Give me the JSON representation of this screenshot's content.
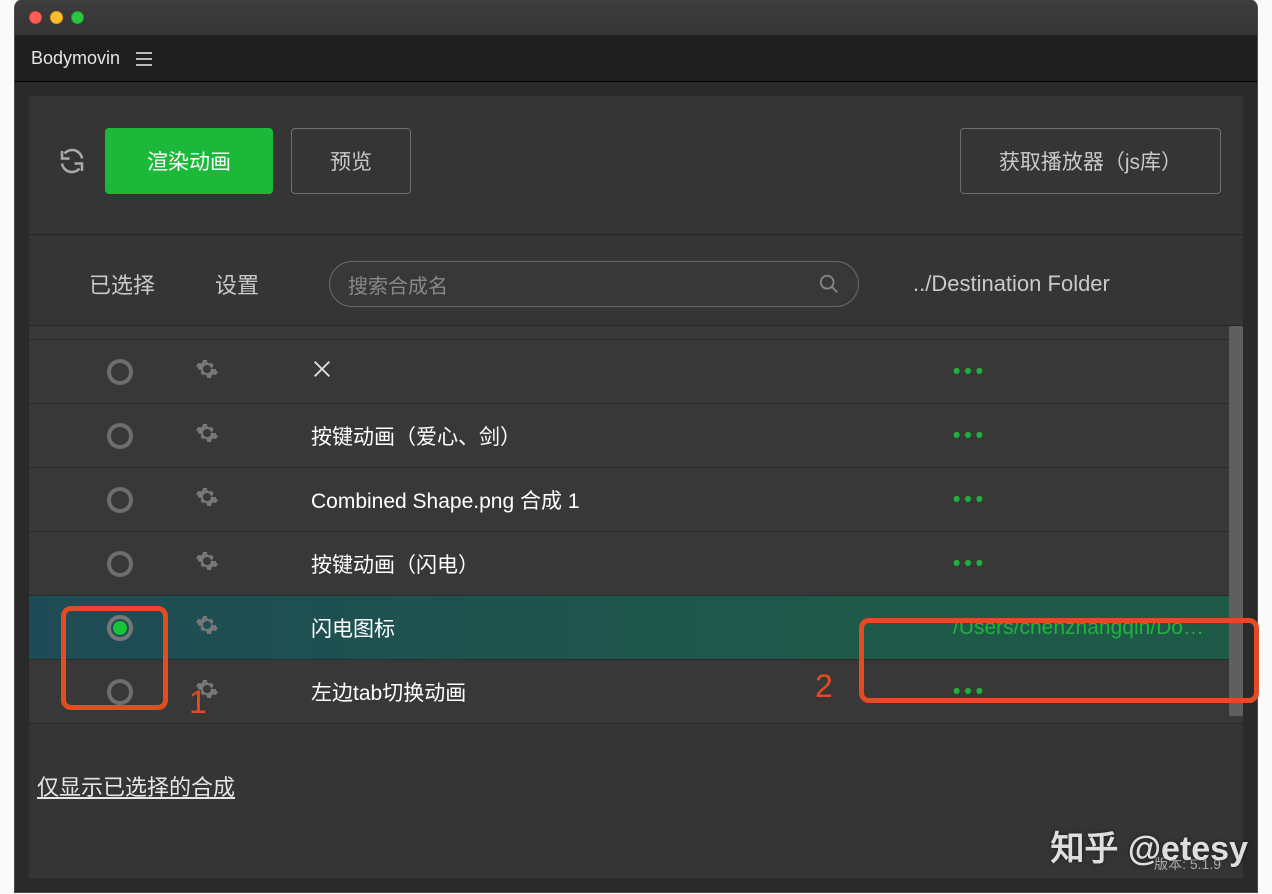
{
  "header": {
    "title": "Bodymovin"
  },
  "toolbar": {
    "render_label": "渲染动画",
    "preview_label": "预览",
    "get_player_label": "获取播放器（js库）"
  },
  "columns": {
    "selected": "已选择",
    "settings": "设置",
    "search_placeholder": "搜索合成名",
    "destination": "../Destination Folder"
  },
  "rows": [
    {
      "name": "✕",
      "selected": false,
      "dest": "•••"
    },
    {
      "name": "按键动画（爱心、剑）",
      "selected": false,
      "dest": "•••"
    },
    {
      "name": "Combined Shape.png 合成 1",
      "selected": false,
      "dest": "•••"
    },
    {
      "name": "按键动画（闪电）",
      "selected": false,
      "dest": "•••"
    },
    {
      "name": "闪电图标",
      "selected": true,
      "dest": "/Users/chenzhangqin/Do…"
    },
    {
      "name": "左边tab切换动画",
      "selected": false,
      "dest": "•••"
    }
  ],
  "footer_link": "仅显示已选择的合成",
  "version_label": "版本: 5.1.9",
  "watermark": "知乎 @etesy",
  "annotations": {
    "one": "1",
    "two": "2"
  }
}
